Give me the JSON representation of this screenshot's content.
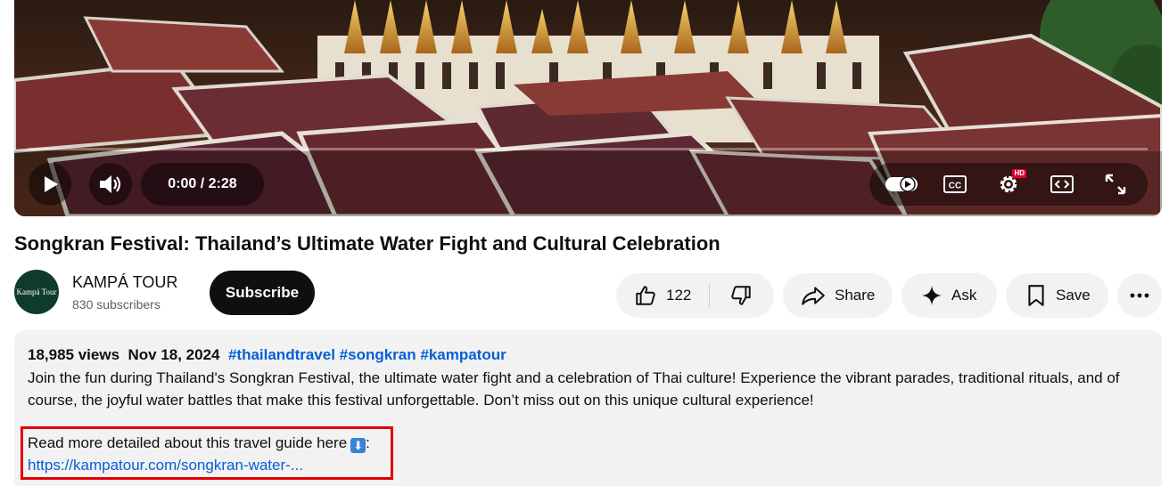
{
  "player": {
    "time_display": "0:00 / 2:28",
    "progress": 0.0,
    "icons": [
      "play-icon",
      "volume-icon",
      "autoplay-toggle-icon",
      "captions-icon",
      "settings-icon",
      "theater-mode-icon",
      "fullscreen-icon"
    ],
    "settings_badge": "HD"
  },
  "video": {
    "title": "Songkran Festival: Thailand’s Ultimate Water Fight and Cultural Celebration"
  },
  "channel": {
    "name": "KAMPÁ TOUR",
    "subscribers": "830 subscribers",
    "avatar_text": "Kampá Tour",
    "subscribe_label": "Subscribe"
  },
  "actions": {
    "like_count": "122",
    "share_label": "Share",
    "ask_label": "Ask",
    "save_label": "Save"
  },
  "description": {
    "views": "18,985 views",
    "date": "Nov 18, 2024",
    "hashtags": "#thailandtravel #songkran #kampatour",
    "text": "Join the fun during Thailand's Songkran Festival, the ultimate water fight and a celebration of Thai culture! Experience the vibrant parades, traditional rituals, and of course, the joyful water battles that make this festival unforgettable. Don’t miss out on this unique cultural experience!",
    "read_more": "Read more detailed about this travel guide here",
    "read_more_suffix": ":",
    "link": "https://kampatour.com/songkran-water-..."
  },
  "colors": {
    "link_blue": "#065fd4",
    "highlight_red": "#e00000",
    "subscribe_bg": "#0f0f0f",
    "button_bg": "#f2f2f2"
  }
}
